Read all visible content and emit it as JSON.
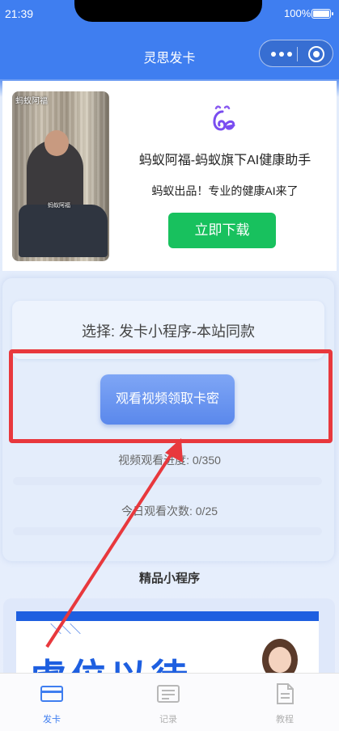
{
  "status_bar": {
    "time": "21:39",
    "battery": "100%"
  },
  "nav": {
    "title": "灵思发卡"
  },
  "ad": {
    "photo_logo_text": "蚂蚁阿福",
    "photo_caption": "蚂蚁阿福",
    "title": "蚂蚁阿福-蚂蚁旗下AI健康助手",
    "subtitle": "蚂蚁出品！专业的健康AI来了",
    "download_label": "立即下载",
    "logo_icon": "ant-afu-logo-icon"
  },
  "main": {
    "select_text": "选择: 发卡小程序-本站同款",
    "watch_button_label": "观看视频领取卡密",
    "video_progress_text": "视频观看进度: 0/350",
    "video_progress_fraction": 0,
    "daily_count_text": "今日观看次数: 0/25",
    "daily_count_fraction": 0
  },
  "section": {
    "title": "精品小程序"
  },
  "promo": {
    "headline": "虚位以待"
  },
  "tabs": [
    {
      "label": "发卡",
      "icon": "card-icon",
      "active": true
    },
    {
      "label": "记录",
      "icon": "record-icon",
      "active": false
    },
    {
      "label": "教程",
      "icon": "document-icon",
      "active": false
    }
  ],
  "colors": {
    "brand": "#3f7ef0",
    "highlight": "#e8383d",
    "download": "#18c15e"
  }
}
